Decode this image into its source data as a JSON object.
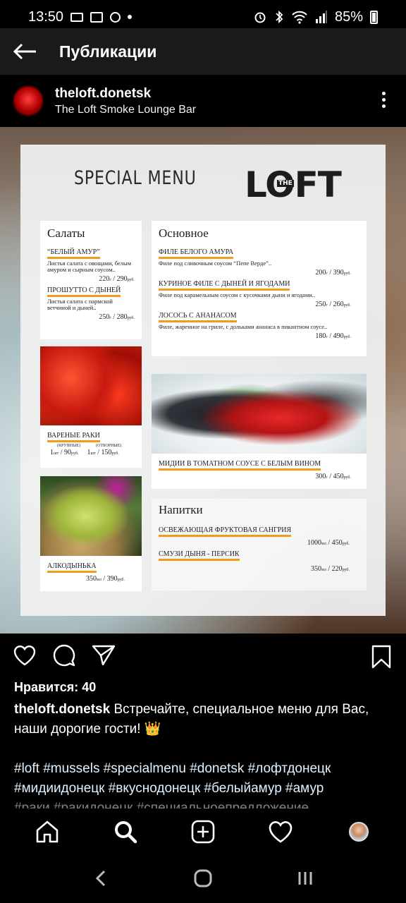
{
  "status_bar": {
    "time": "13:50",
    "battery": "85%",
    "icons_left": [
      "screen-icon",
      "gallery-icon",
      "search-icon",
      "dot-icon"
    ],
    "icons_right": [
      "alarm-icon",
      "bluetooth-icon",
      "wifi-icon",
      "signal-icon",
      "battery-icon"
    ]
  },
  "appbar": {
    "title": "Публикации"
  },
  "post": {
    "username": "theloft.donetsk",
    "location": "The Loft Smoke Lounge Bar",
    "likes": "Нравится: 40",
    "caption_user": "theloft.donetsk",
    "caption_text": "Встречайте, специальное меню для Вас, наши дорогие гости! 👑",
    "hashtags_line1": "#loft #mussels #specialmenu #donetsk #лофтдонецк",
    "hashtags_line2": "#мидиидонецк #вкуснодонецк #белыйамур #амур",
    "hashtags_line3": "#раки #ракидонецк #специальноепредложение"
  },
  "menu": {
    "header": "SPECIAL MENU",
    "logo": "LOFT",
    "logo_small": "THE",
    "salads": {
      "title": "Салаты",
      "items": [
        {
          "name": "“БЕЛЫЙ АМУР”",
          "desc": "Листья салата с овощами, белым амуром и сырным соусом..",
          "price": "220",
          "price2": "290",
          "unit": "г",
          "cur": "руб."
        },
        {
          "name": "ПРОШУТТО С ДЫНЕЙ",
          "desc": "Листья салата с пармской ветчиной и дыней..",
          "price": "250",
          "price2": "280",
          "unit": "г",
          "cur": "руб."
        }
      ]
    },
    "main": {
      "title": "Основное",
      "items": [
        {
          "name": "ФИЛЕ БЕЛОГО АМУРА",
          "desc": "Филе под сливочным соусом “Пепе Верде”..",
          "price": "200",
          "price2": "390"
        },
        {
          "name": "КУРИНОЕ ФИЛЕ С ДЫНЕЙ И ЯГОДАМИ",
          "desc": "Филе под карамельным соусом с кусочками дыни и ягодами..",
          "price": "250",
          "price2": "260"
        },
        {
          "name": "ЛОСОСЬ С АНАНАСОМ",
          "desc": "Филе, жаренное на гриле, с дольками ананаса в пикантном соусе..",
          "price": "180",
          "price2": "490"
        }
      ]
    },
    "crayfish": {
      "name": "ВАРЕНЫЕ РАКИ",
      "opt1": "(КРУПНЫЕ)",
      "opt2": "(ОТБОРНЫЕ)",
      "p1": "1",
      "p1b": "90",
      "p2": "1",
      "p2b": "150",
      "unit": "шт",
      "cur": "руб."
    },
    "mussels": {
      "name": "МИДИИ В ТОМАТНОМ СОУСЕ С БЕЛЫМ ВИНОМ",
      "price": "300",
      "price2": "450",
      "unit": "г",
      "cur": "руб."
    },
    "alko": {
      "name": "АЛКОДЫНЬКА",
      "price": "350",
      "price2": "390",
      "unit": "мл",
      "cur": "руб."
    },
    "drinks": {
      "title": "Напитки",
      "items": [
        {
          "name": "ОСВЕЖАЮЩАЯ ФРУКТОВАЯ САНГРИЯ",
          "price": "1000",
          "price2": "450",
          "unit": "мл",
          "cur": "руб."
        },
        {
          "name": "СМУЗИ ДЫНЯ - ПЕРСИК",
          "price": "350",
          "price2": "220",
          "unit": "мл",
          "cur": "руб."
        }
      ]
    }
  },
  "colors": {
    "accent_underline": "#f29a1a",
    "appbar_bg": "#1a1a1a",
    "background": "#000000"
  }
}
